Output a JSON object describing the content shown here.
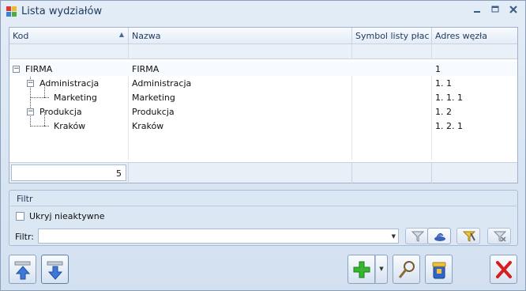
{
  "window": {
    "title": "Lista wydziałów",
    "controls": [
      "minimize-icon",
      "maximize-icon",
      "close-icon"
    ]
  },
  "grid": {
    "columns": [
      {
        "label": "Kod",
        "sorted": "ascending"
      },
      {
        "label": "Nazwa"
      },
      {
        "label": "Symbol listy płac"
      },
      {
        "label": "Adres węzła"
      }
    ],
    "rows": [
      {
        "kod": "FIRMA",
        "nazwa": "FIRMA",
        "symbol": "",
        "adres": "1",
        "level": 0,
        "expanded": true
      },
      {
        "kod": "Administracja",
        "nazwa": "Administracja",
        "symbol": "",
        "adres": "1.  1",
        "level": 1,
        "expanded": true
      },
      {
        "kod": "Marketing",
        "nazwa": "Marketing",
        "symbol": "",
        "adres": "1.  1.  1",
        "level": 2
      },
      {
        "kod": "Produkcja",
        "nazwa": "Produkcja",
        "symbol": "",
        "adres": "1.  2",
        "level": 1,
        "expanded": true
      },
      {
        "kod": "Kraków",
        "nazwa": "Kraków",
        "symbol": "",
        "adres": "1.  2.  1",
        "level": 2
      }
    ],
    "footer_count": "5"
  },
  "filter_group": {
    "title": "Filtr",
    "hide_inactive_label": "Ukryj nieaktywne",
    "hide_inactive_checked": false,
    "filter_label": "Filtr:",
    "filter_value": "",
    "buttons": [
      "filter-icon",
      "filter-toggle-icon",
      "filter-apply-icon",
      "filter-clear-icon"
    ]
  },
  "toolbar_bottom": {
    "left_buttons": [
      "move-up-icon",
      "move-down-icon"
    ],
    "right_buttons": [
      "add-icon",
      "edit-icon",
      "delete-icon",
      "cancel-icon"
    ]
  },
  "colors": {
    "accent": "#1e395b",
    "add_green": "#2ea829",
    "cancel_red": "#d51f1f"
  }
}
